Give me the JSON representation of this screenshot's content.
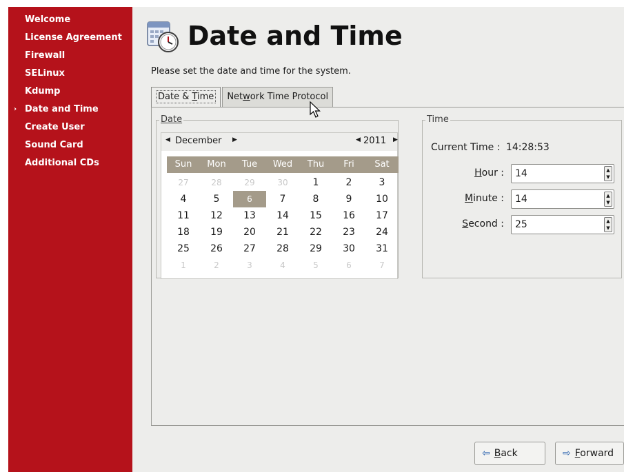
{
  "sidebar": {
    "items": [
      {
        "label": "Welcome"
      },
      {
        "label": "License Agreement"
      },
      {
        "label": "Firewall"
      },
      {
        "label": "SELinux"
      },
      {
        "label": "Kdump"
      },
      {
        "label": "Date and Time",
        "current": true
      },
      {
        "label": "Create User"
      },
      {
        "label": "Sound Card"
      },
      {
        "label": "Additional CDs"
      }
    ],
    "current_marker": "›"
  },
  "header": {
    "title": "Date and Time",
    "icon": "calendar-clock-icon",
    "subtitle": "Please set the date and time for the system."
  },
  "tabs": [
    {
      "pre": "Date & ",
      "mnemonic": "T",
      "post": "ime",
      "active": true
    },
    {
      "pre": "Net",
      "mnemonic": "w",
      "post": "ork Time Protocol",
      "active": false
    }
  ],
  "date_frame": {
    "label": "Date",
    "month": "December",
    "year": "2011",
    "weekdays": [
      "Sun",
      "Mon",
      "Tue",
      "Wed",
      "Thu",
      "Fri",
      "Sat"
    ],
    "days": [
      [
        "27",
        "28",
        "29",
        "30",
        "1",
        "2",
        "3"
      ],
      [
        "4",
        "5",
        "6",
        "7",
        "8",
        "9",
        "10"
      ],
      [
        "11",
        "12",
        "13",
        "14",
        "15",
        "16",
        "17"
      ],
      [
        "18",
        "19",
        "20",
        "21",
        "22",
        "23",
        "24"
      ],
      [
        "25",
        "26",
        "27",
        "28",
        "29",
        "30",
        "31"
      ],
      [
        "1",
        "2",
        "3",
        "4",
        "5",
        "6",
        "7"
      ]
    ],
    "selected_day": "6"
  },
  "time_frame": {
    "label": "Time",
    "current_time_label": "Current Time :",
    "current_time_value": "14:28:53",
    "hour": {
      "mnemonic": "H",
      "rest": "our",
      "suffix": " :",
      "value": "14"
    },
    "minute": {
      "mnemonic": "M",
      "rest": "inute",
      "suffix": " :",
      "value": "14"
    },
    "second": {
      "mnemonic": "S",
      "rest": "econd",
      "suffix": " :",
      "value": "25"
    }
  },
  "buttons": {
    "back": {
      "mnemonic": "B",
      "rest": "ack"
    },
    "forward": {
      "mnemonic": "F",
      "rest": "orward"
    }
  },
  "colors": {
    "sidebar_bg": "#b5121b",
    "panel_bg": "#ededeb",
    "calendar_header": "#a49b8a",
    "button_arrow": "#2f66b0"
  }
}
